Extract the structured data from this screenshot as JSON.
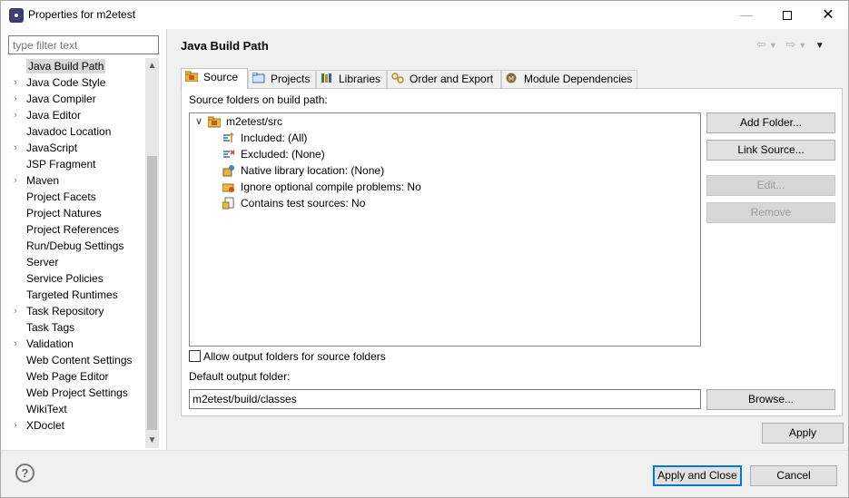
{
  "window": {
    "title": "Properties for m2etest"
  },
  "filter": {
    "placeholder": "type filter text"
  },
  "nav_items": [
    {
      "label": "Java Build Path",
      "expandable": false,
      "selected": true
    },
    {
      "label": "Java Code Style",
      "expandable": true
    },
    {
      "label": "Java Compiler",
      "expandable": true
    },
    {
      "label": "Java Editor",
      "expandable": true
    },
    {
      "label": "Javadoc Location",
      "expandable": false
    },
    {
      "label": "JavaScript",
      "expandable": true
    },
    {
      "label": "JSP Fragment",
      "expandable": false
    },
    {
      "label": "Maven",
      "expandable": true
    },
    {
      "label": "Project Facets",
      "expandable": false
    },
    {
      "label": "Project Natures",
      "expandable": false
    },
    {
      "label": "Project References",
      "expandable": false
    },
    {
      "label": "Run/Debug Settings",
      "expandable": false
    },
    {
      "label": "Server",
      "expandable": false
    },
    {
      "label": "Service Policies",
      "expandable": false
    },
    {
      "label": "Targeted Runtimes",
      "expandable": false
    },
    {
      "label": "Task Repository",
      "expandable": true
    },
    {
      "label": "Task Tags",
      "expandable": false
    },
    {
      "label": "Validation",
      "expandable": true
    },
    {
      "label": "Web Content Settings",
      "expandable": false
    },
    {
      "label": "Web Page Editor",
      "expandable": false
    },
    {
      "label": "Web Project Settings",
      "expandable": false
    },
    {
      "label": "WikiText",
      "expandable": false
    },
    {
      "label": "XDoclet",
      "expandable": true
    }
  ],
  "page": {
    "title": "Java Build Path"
  },
  "tabs": [
    {
      "label": "Source",
      "active": true
    },
    {
      "label": "Projects"
    },
    {
      "label": "Libraries"
    },
    {
      "label": "Order and Export"
    },
    {
      "label": "Module Dependencies"
    }
  ],
  "source": {
    "section_label": "Source folders on build path:",
    "root": "m2etest/src",
    "children": [
      "Included: (All)",
      "Excluded: (None)",
      "Native library location: (None)",
      "Ignore optional compile problems: No",
      "Contains test sources: No"
    ],
    "buttons": {
      "add_folder": "Add Folder...",
      "link_source": "Link Source...",
      "edit": "Edit...",
      "remove": "Remove"
    },
    "allow_output_label": "Allow output folders for source folders",
    "allow_output_checked": false,
    "default_output_label": "Default output folder:",
    "default_output_value": "m2etest/build/classes",
    "browse": "Browse..."
  },
  "actions": {
    "apply": "Apply",
    "apply_close": "Apply and Close",
    "cancel": "Cancel"
  },
  "colors": {
    "accent": "#0078d7",
    "selection": "#d9d9d9"
  }
}
